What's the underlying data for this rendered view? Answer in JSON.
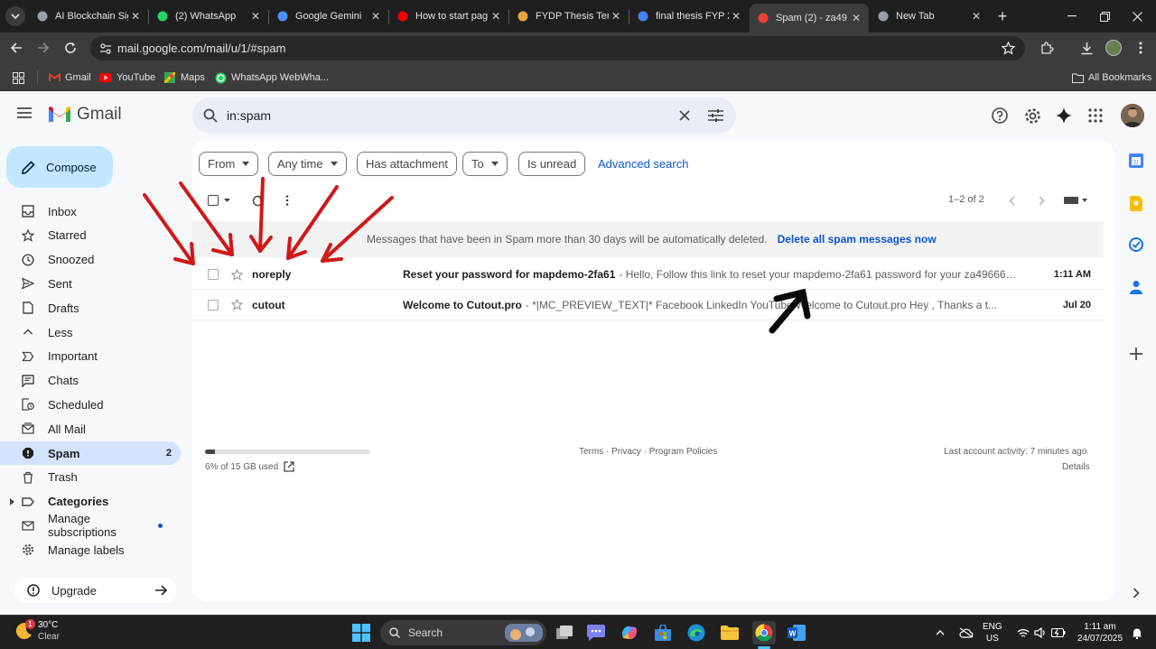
{
  "browser": {
    "tabs": [
      {
        "title": "AI Blockchain Sig",
        "icon": "ai-blockchain-favicon",
        "color": "#9aa0a6"
      },
      {
        "title": "(2) WhatsApp",
        "icon": "whatsapp-favicon",
        "color": "#25d366"
      },
      {
        "title": "Google Gemini",
        "icon": "gemini-favicon",
        "color": "#4b90ff"
      },
      {
        "title": "How to start pag",
        "icon": "youtube-favicon",
        "color": "#ff0000"
      },
      {
        "title": "FYDP Thesis Tem",
        "icon": "overleaf-favicon",
        "color": "#e8a33a"
      },
      {
        "title": "final thesis FYP 2",
        "icon": "docs-favicon",
        "color": "#4285f4"
      },
      {
        "title": "Spam (2) - za49",
        "icon": "gmail-favicon",
        "color": "#ea4335",
        "active": true
      },
      {
        "title": "New Tab",
        "icon": "chrome-favicon",
        "color": "#9aa0a6"
      }
    ],
    "url": "mail.google.com/mail/u/1/#spam",
    "bookmarks": [
      {
        "label": "Gmail",
        "icon": "gmail-icon"
      },
      {
        "label": "YouTube",
        "icon": "youtube-icon"
      },
      {
        "label": "Maps",
        "icon": "maps-icon"
      },
      {
        "label": "WhatsApp WebWha...",
        "icon": "whatsapp-icon"
      }
    ],
    "all_bookmarks": "All Bookmarks"
  },
  "gmail": {
    "logo_text": "Gmail",
    "search_query": "in:spam",
    "compose_label": "Compose",
    "nav": [
      {
        "label": "Inbox",
        "icon": "inbox-icon",
        "count": ""
      },
      {
        "label": "Starred",
        "icon": "star-icon",
        "count": ""
      },
      {
        "label": "Snoozed",
        "icon": "clock-icon",
        "count": ""
      },
      {
        "label": "Sent",
        "icon": "send-icon",
        "count": ""
      },
      {
        "label": "Drafts",
        "icon": "draft-icon",
        "count": ""
      },
      {
        "label": "Less",
        "icon": "chevron-up-icon",
        "count": ""
      },
      {
        "label": "Important",
        "icon": "important-icon",
        "count": ""
      },
      {
        "label": "Chats",
        "icon": "chat-icon",
        "count": ""
      },
      {
        "label": "Scheduled",
        "icon": "scheduled-icon",
        "count": ""
      },
      {
        "label": "All Mail",
        "icon": "all-mail-icon",
        "count": ""
      },
      {
        "label": "Spam",
        "icon": "spam-icon",
        "count": "2",
        "active": true
      },
      {
        "label": "Trash",
        "icon": "trash-icon",
        "count": ""
      },
      {
        "label": "Categories",
        "icon": "label-icon",
        "count": "",
        "bold": true
      },
      {
        "label": "Manage subscriptions",
        "icon": "subscriptions-icon",
        "count": ""
      },
      {
        "label": "Manage labels",
        "icon": "gear-icon",
        "count": ""
      }
    ],
    "upgrade_label": "Upgrade",
    "filters": [
      "From",
      "Any time",
      "Has attachment",
      "To",
      "Is unread"
    ],
    "advanced_search": "Advanced search",
    "page_info": "1–2 of 2",
    "banner_text": "Messages that have been in Spam more than 30 days will be automatically deleted.",
    "banner_action": "Delete all spam messages now",
    "emails": [
      {
        "sender": "noreply",
        "subject": "Reset your password for mapdemo-2fa61",
        "snippet": "- Hello, Follow this link to reset your mapdemo-2fa61 password for your za496666@...",
        "date": "1:11 AM"
      },
      {
        "sender": "cutout",
        "subject": "Welcome to Cutout.pro",
        "snippet": "- *|MC_PREVIEW_TEXT|* Facebook LinkedIn YouTube Welcome to Cutout.pro Hey ,   Thanks a t...",
        "date": "Jul 20"
      }
    ],
    "storage": {
      "text": "6% of 15 GB used",
      "fraction": 0.06
    },
    "footer_links": "Terms · Privacy · Program Policies",
    "last_activity": "Last account activity: 7 minutes ago",
    "details": "Details"
  },
  "taskbar": {
    "weather_temp": "30°C",
    "weather_desc": "Clear",
    "weather_badge": "1",
    "search_label": "Search",
    "lang": "ENG",
    "region": "US",
    "time": "1:11 am",
    "date": "24/07/2025"
  },
  "colors": {
    "annotation_red": "#d01818",
    "annotation_black": "#0a0a0a",
    "accent_blue": "#0b57d0"
  }
}
